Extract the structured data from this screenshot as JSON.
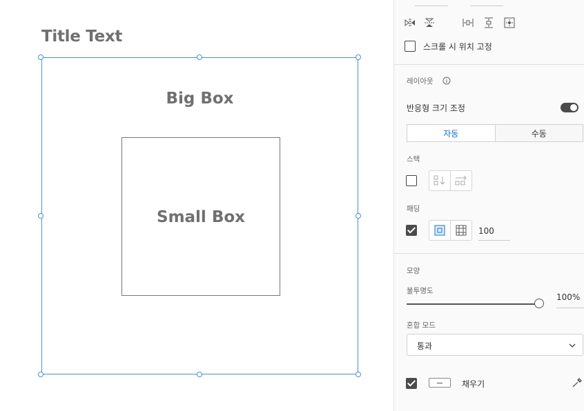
{
  "canvas": {
    "title_text": "Title Text",
    "big_box_label": "Big Box",
    "small_box_label": "Small Box",
    "selection_color": "#4b8fd6"
  },
  "panel": {
    "fix_position_label": "스크롤 시 위치 고정",
    "fix_position_checked": false,
    "layout_label": "레이아웃",
    "responsive_resize_label": "반응형 크기 조정",
    "responsive_resize_on": true,
    "resize_modes": [
      "자동",
      "수동"
    ],
    "resize_mode_selected": "자동",
    "stack_label": "스택",
    "stack_checked": false,
    "padding_label": "패딩",
    "padding_checked": true,
    "padding_value": "100",
    "appearance_label": "모양",
    "opacity_label": "불투명도",
    "opacity_value": "100%",
    "opacity_level": 1.0,
    "blend_mode_label": "혼합 모드",
    "blend_mode_value": "통과",
    "fill_label": "채우기",
    "fill_checked": true,
    "accent_color": "#1473c8"
  },
  "icons": {
    "flip_horizontal": "flip-horizontal-icon",
    "flip_vertical": "flip-vertical-icon",
    "distribute_horizontal": "distribute-horizontal-icon",
    "distribute_vertical": "distribute-vertical-icon",
    "align_center": "align-center-icon",
    "info": "info-icon",
    "stack_vertical": "stack-vertical-icon",
    "stack_horizontal": "stack-horizontal-icon",
    "padding_uniform": "padding-uniform-icon",
    "padding_individual": "padding-individual-icon",
    "dropdown": "chevron-down-icon",
    "eyedropper": "eyedropper-icon"
  }
}
